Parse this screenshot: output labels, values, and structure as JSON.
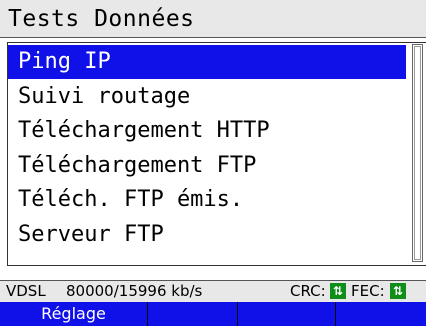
{
  "title": "Tests Données",
  "menu": {
    "items": [
      {
        "label": "Ping IP",
        "selected": true
      },
      {
        "label": "Suivi routage",
        "selected": false
      },
      {
        "label": "Téléchargement HTTP",
        "selected": false
      },
      {
        "label": "Téléchargement FTP",
        "selected": false
      },
      {
        "label": "Téléch. FTP émis.",
        "selected": false
      },
      {
        "label": "Serveur FTP",
        "selected": false
      }
    ]
  },
  "status": {
    "mode": "VDSL",
    "rate": "80000/15996 kb/s",
    "crc_label": "CRC:",
    "fec_label": "FEC:",
    "indicator_color": "#0f8f1a"
  },
  "softkeys": [
    "Réglage",
    "",
    "",
    ""
  ],
  "colors": {
    "selection": "#1010e8",
    "softkey_bar": "#1010e8",
    "title_bg": "#e8e8e8"
  }
}
